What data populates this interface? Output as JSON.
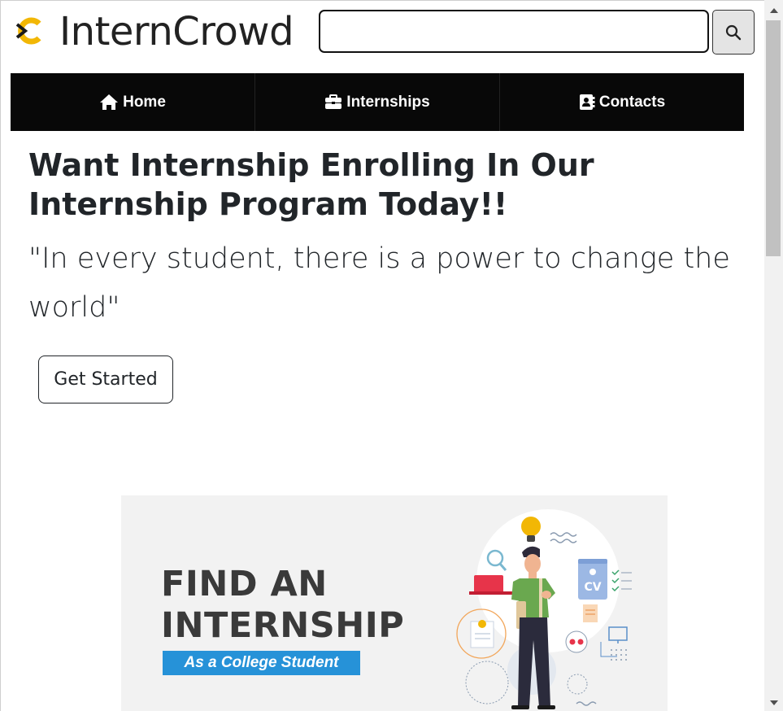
{
  "header": {
    "brand": "InternCrowd",
    "logo_icon": "interncrowd-logo",
    "search_placeholder": "",
    "search_value": "",
    "search_icon": "search-icon"
  },
  "nav": {
    "items": [
      {
        "label": "Home",
        "icon": "home-icon"
      },
      {
        "label": "Internships",
        "icon": "briefcase-icon"
      },
      {
        "label": "Contacts",
        "icon": "contact-book-icon"
      }
    ]
  },
  "hero": {
    "title": "Want Internship Enrolling In Our Internship Program Today!!",
    "quote": "\"In every student, there is a power to change the world\"",
    "cta_label": "Get Started"
  },
  "banner": {
    "line1": "FIND AN",
    "line2": "INTERNSHIP",
    "tag": "As a College Student",
    "cv_label": "CV",
    "accent": "#2692d8"
  },
  "colors": {
    "navbar_bg": "#080808",
    "text": "#212529",
    "banner_bg": "#f2f2f2"
  }
}
